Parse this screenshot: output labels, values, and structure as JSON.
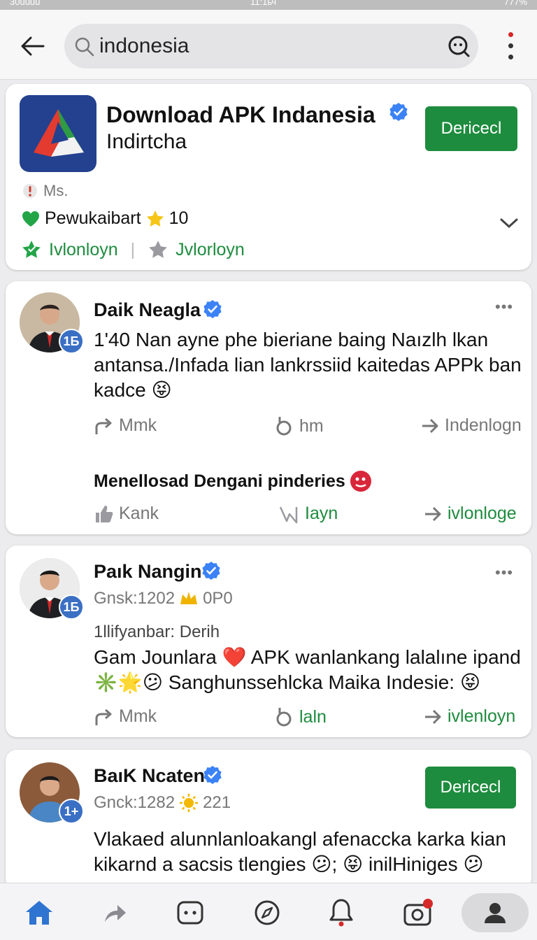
{
  "status_bar": {
    "left": "30uuuu",
    "time": "11:1ьч",
    "battery": "777%"
  },
  "search": {
    "query": "indonesia"
  },
  "app_card": {
    "title": "Download APK Indanesia",
    "subtitle": "Indirtcha",
    "install_label": "Dericecl",
    "meta": "Ms.",
    "rating_label": "Pewukaibart",
    "rating_value": "10",
    "link1": "Ivlonloyn",
    "link2": "Jvlorloyn"
  },
  "posts": [
    {
      "author": "Daik Neagla",
      "badge": "1Б",
      "text": "1'40 Nan ayne phe bieriane baing Naızlh lkan antansa./Infada lian lankrssiid kaitedas APPk ban kadce 😝",
      "actions": [
        "Mmk",
        "hm",
        "Indenlogn"
      ],
      "sub_heading": "Menellosad Dengani pinderies",
      "sub_actions": [
        "Kank",
        "Iayn",
        "ivlonloge"
      ]
    },
    {
      "author": "Paık Nangin",
      "badge": "1Б",
      "meta_line": "Gnsk:1202",
      "meta_count": "0P0",
      "meta_line2": "1llifyanbar: Derih",
      "text": "Gam Jounlara ❤️ APK wanlankang lalalıne ipand ✳️🌟😕 Sanghunssehlcka Maika Indesie: 😝",
      "actions": [
        "Mmk",
        "laln",
        "ivlenloyn"
      ]
    },
    {
      "author": "BaıK Ncaten",
      "badge": "1+",
      "meta_line": "Gnck:1282",
      "meta_count": "221",
      "button_label": "Dericecl",
      "text": "Vlakaed alunnlanloakangl afenaccka karka kian kikarnd a sacsis tlengies 😕; 😝 inilHiniges 😕"
    }
  ],
  "nav": [
    "home",
    "forward",
    "chat",
    "explore",
    "notifications",
    "camera",
    "profile"
  ],
  "colors": {
    "accent_green": "#1e8c3e",
    "verified_blue": "#3b82f6",
    "brand_blue": "#23418f"
  }
}
